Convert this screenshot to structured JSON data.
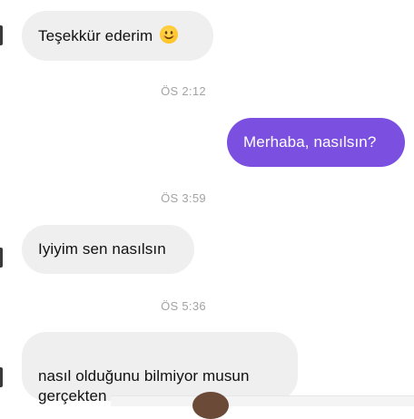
{
  "conversation": {
    "messages": [
      {
        "direction": "incoming",
        "text": "Teşekkür ederim",
        "emoji": "smiling-face-icon"
      },
      {
        "direction": "outgoing",
        "text": "Merhaba, nasılsın?"
      },
      {
        "direction": "incoming",
        "text": "Iyiyim sen nasılsın"
      },
      {
        "direction": "incoming",
        "text": "nasıl olduğunu bilmiyor musun\ngerçekten"
      }
    ],
    "timestamps": [
      "ÖS 2:12",
      "ÖS 3:59",
      "ÖS 5:36"
    ]
  },
  "colors": {
    "outgoing_bubble": "#7b4fe0",
    "incoming_bubble": "#efefef",
    "timestamp_text": "#a3a3a3"
  }
}
